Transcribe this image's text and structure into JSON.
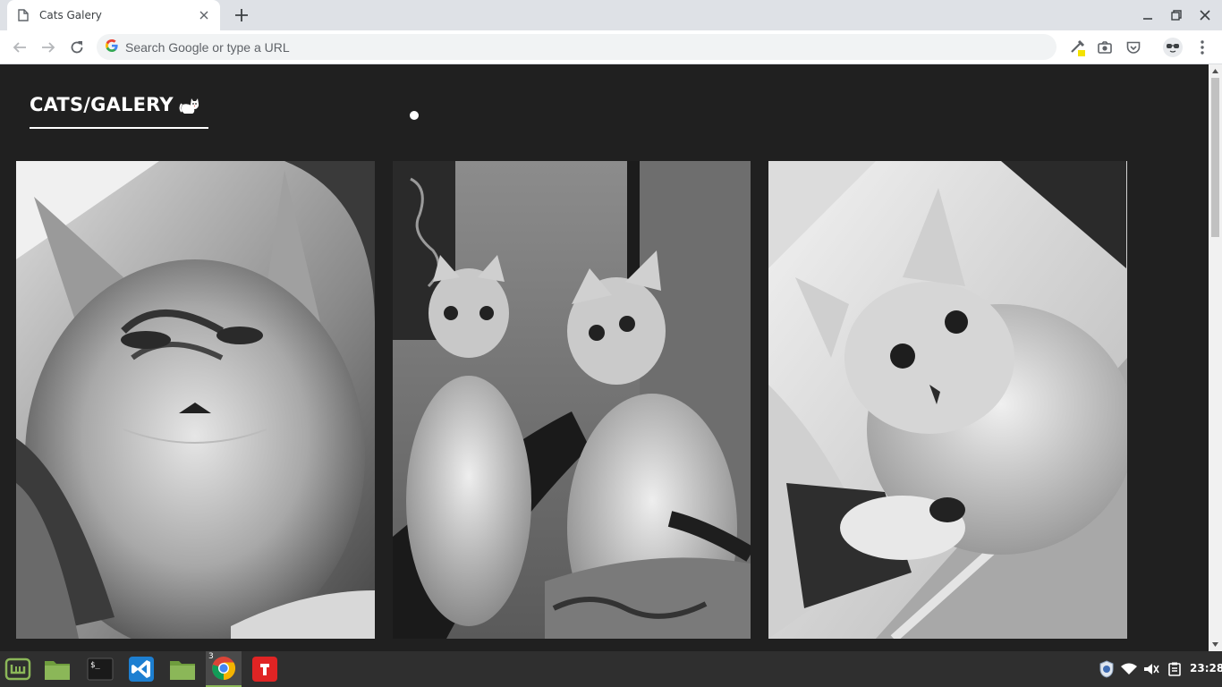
{
  "browser": {
    "tab": {
      "title": "Cats Galery",
      "favicon": "page-icon",
      "close_icon": "close-icon"
    },
    "new_tab_icon": "plus-icon",
    "window_controls": [
      "minimize-icon",
      "restore-icon",
      "close-icon"
    ],
    "toolbar": {
      "back_icon": "back-arrow-icon",
      "forward_icon": "forward-arrow-icon",
      "reload_icon": "reload-icon",
      "omnibox": {
        "value": "",
        "placeholder": "Search Google or type a URL",
        "icon": "google-g-icon"
      },
      "extensions": [
        "color-picker-icon",
        "camera-icon",
        "pocket-icon"
      ],
      "menu_icon": "kebab-menu-icon"
    }
  },
  "page": {
    "logo": {
      "text": "CATS/GALERY",
      "icon": "cat-emoji-icon"
    },
    "gallery": [
      {
        "alt": "cat-photo-1",
        "subject": "close-up of a tabby-point cat lying on a blanket"
      },
      {
        "alt": "cat-photo-2",
        "subject": "cat sitting in front of a mirror looking up"
      },
      {
        "alt": "cat-photo-3",
        "subject": "cat lying on a floor looking at the camera"
      }
    ]
  },
  "taskbar": {
    "apps": [
      {
        "name": "menu-mint-icon"
      },
      {
        "name": "files-icon"
      },
      {
        "name": "terminal-icon"
      },
      {
        "name": "vscode-icon"
      },
      {
        "name": "folder-icon"
      },
      {
        "name": "chrome-icon",
        "badge": "3",
        "active": true
      },
      {
        "name": "app-red-icon"
      }
    ],
    "tray": [
      "shield-icon",
      "wifi-icon",
      "volume-icon",
      "clipboard-icon"
    ],
    "clock": "23:28"
  },
  "colors": {
    "page_bg": "#202020",
    "tabstrip_bg": "#dee1e6",
    "taskbar_bg": "#2f2f2f",
    "accent_mint": "#8bb758"
  }
}
